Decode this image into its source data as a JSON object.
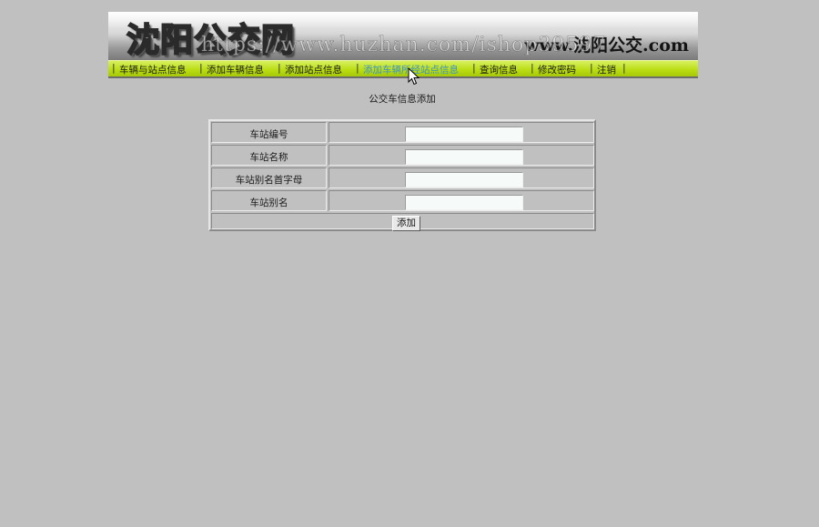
{
  "header": {
    "logo_text": "沈阳公交网",
    "site_url": "www.沈阳公交.com",
    "watermark": "https://www.huzhan.com/ishop39597"
  },
  "nav": {
    "items": [
      {
        "label": "车辆与站点信息",
        "active": false
      },
      {
        "label": "添加车辆信息",
        "active": false
      },
      {
        "label": "添加站点信息",
        "active": false
      },
      {
        "label": "添加车辆所经站点信息",
        "active": true
      },
      {
        "label": "查询信息",
        "active": false
      },
      {
        "label": "修改密码",
        "active": false
      },
      {
        "label": "注销",
        "active": false
      }
    ],
    "separator": "|"
  },
  "page": {
    "title": "公交车信息添加"
  },
  "form": {
    "fields": [
      {
        "label": "车站编号",
        "value": "",
        "placeholder": ""
      },
      {
        "label": "车站名称",
        "value": "",
        "placeholder": ""
      },
      {
        "label": "车站别名首字母",
        "value": "",
        "placeholder": ""
      },
      {
        "label": "车站别名",
        "value": "",
        "placeholder": ""
      }
    ],
    "submit_label": "添加"
  },
  "colors": {
    "background": "#c0c0c0",
    "nav_bar": "#b8dc10",
    "nav_active_text": "#3b8fd0",
    "input_background": "#f6faf8"
  },
  "icons": {
    "cursor": "arrow-cursor-icon"
  }
}
